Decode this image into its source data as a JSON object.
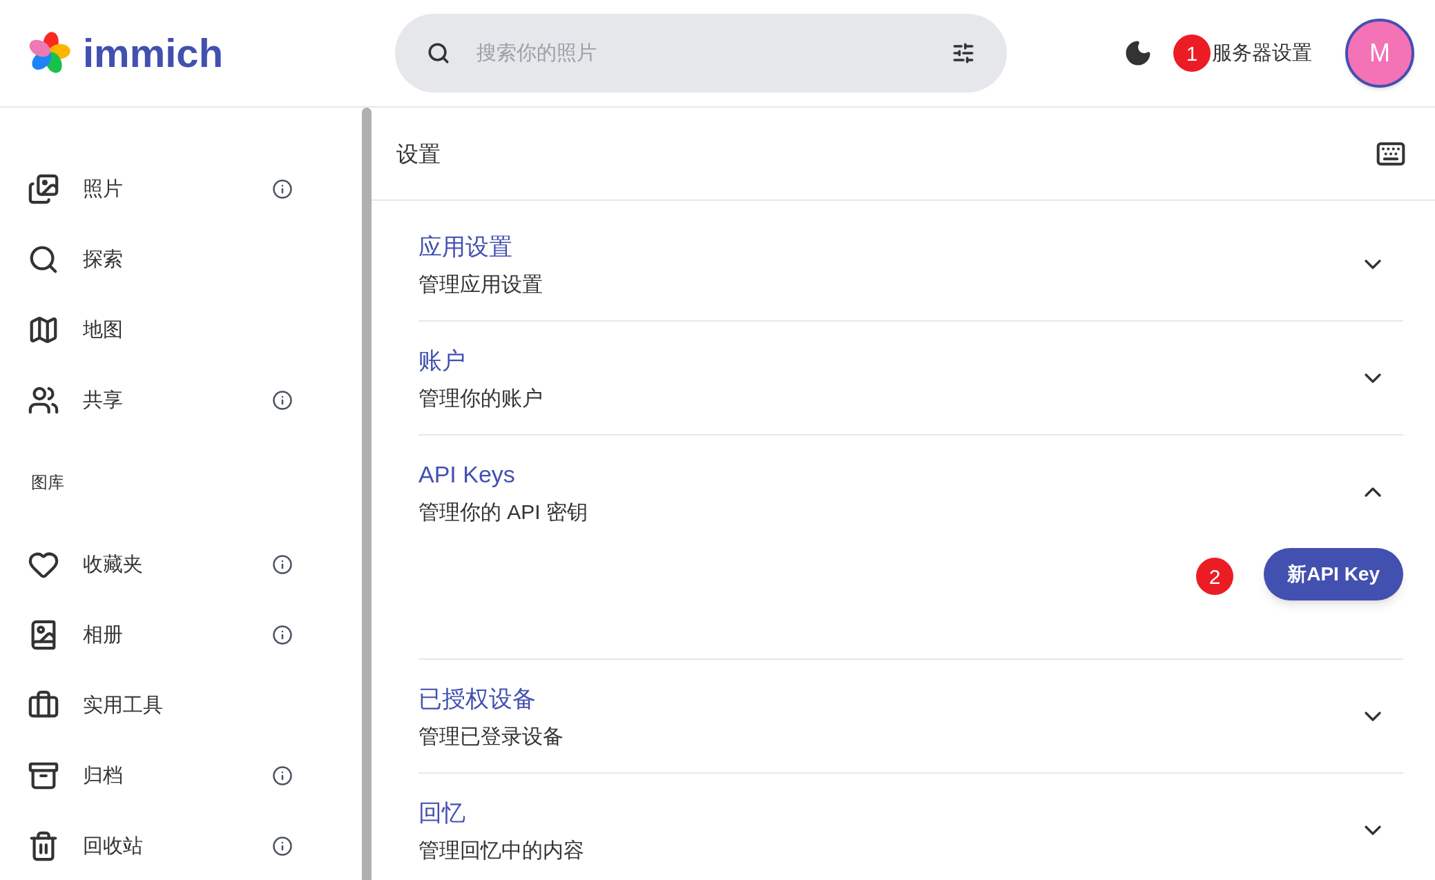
{
  "header": {
    "logo_text": "immich",
    "search": {
      "placeholder": "搜索你的照片"
    },
    "server_settings": {
      "label": "服务器设置",
      "marker": "1"
    },
    "avatar": {
      "initial": "M"
    }
  },
  "sidebar": {
    "items": [
      {
        "label": "照片",
        "info": true
      },
      {
        "label": "探索",
        "info": false
      },
      {
        "label": "地图",
        "info": false
      },
      {
        "label": "共享",
        "info": true
      }
    ],
    "library_heading": "图库",
    "library_items": [
      {
        "label": "收藏夹",
        "info": true
      },
      {
        "label": "相册",
        "info": true
      },
      {
        "label": "实用工具",
        "info": false
      },
      {
        "label": "归档",
        "info": true
      },
      {
        "label": "回收站",
        "info": true
      }
    ]
  },
  "settings": {
    "title": "设置",
    "sections": [
      {
        "title": "应用设置",
        "subtitle": "管理应用设置",
        "expanded": false
      },
      {
        "title": "账户",
        "subtitle": "管理你的账户",
        "expanded": false
      },
      {
        "title": "API Keys",
        "subtitle": "管理你的 API 密钥",
        "expanded": true,
        "button": {
          "label": "新API Key",
          "marker": "2"
        }
      },
      {
        "title": "已授权设备",
        "subtitle": "管理已登录设备",
        "expanded": false
      },
      {
        "title": "回忆",
        "subtitle": "管理回忆中的内容",
        "expanded": false
      }
    ]
  }
}
